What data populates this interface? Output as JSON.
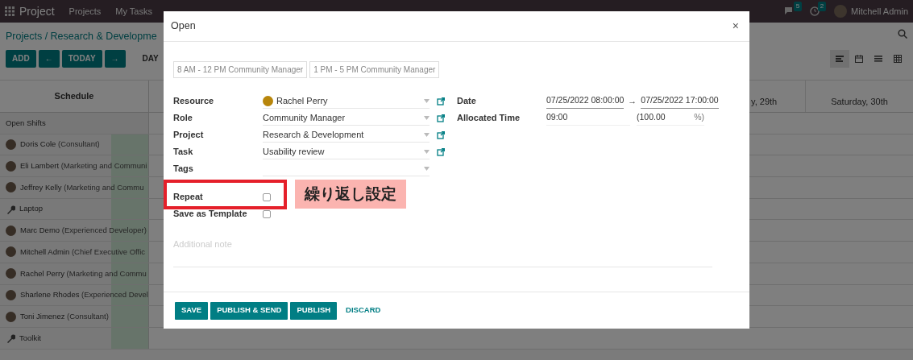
{
  "navbar": {
    "app": "Project",
    "menu": [
      "Projects",
      "My Tasks"
    ],
    "messages_badge": "5",
    "activities_badge": "2",
    "user": "Mitchell Admin"
  },
  "breadcrumb": "Projects / Research & Developme",
  "toolbar": [
    {
      "kind": "primary",
      "label": "ADD"
    },
    {
      "kind": "primary",
      "label": "←"
    },
    {
      "kind": "primary",
      "label": "TODAY"
    },
    {
      "kind": "primary",
      "label": "→"
    },
    {
      "kind": "scale",
      "label": "DAY"
    }
  ],
  "views": [
    {
      "kind": "gantt",
      "selected": true
    },
    {
      "kind": "calendar",
      "selected": false
    },
    {
      "kind": "list",
      "selected": false
    },
    {
      "kind": "pivot",
      "selected": false
    }
  ],
  "gantt": {
    "header": "Schedule",
    "columns": [
      "y, 29th",
      "Saturday, 30th"
    ],
    "rows": [
      {
        "kind": "group",
        "name": "Open Shifts"
      },
      {
        "kind": "person",
        "name": "Doris Cole",
        "role": "(Consultant)"
      },
      {
        "kind": "person",
        "name": "Eli Lambert",
        "role": "(Marketing and Communi"
      },
      {
        "kind": "person",
        "name": "Jeffrey Kelly",
        "role": "(Marketing and Commu"
      },
      {
        "kind": "equipment",
        "name": "Laptop"
      },
      {
        "kind": "person",
        "name": "Marc Demo",
        "role": "(Experienced Developer)"
      },
      {
        "kind": "person",
        "name": "Mitchell Admin",
        "role": "(Chief Executive Offic"
      },
      {
        "kind": "person",
        "name": "Rachel Perry",
        "role": "(Marketing and Commu"
      },
      {
        "kind": "person",
        "name": "Sharlene Rhodes",
        "role": "(Experienced Devel"
      },
      {
        "kind": "person",
        "name": "Toni Jimenez",
        "role": "(Consultant)"
      },
      {
        "kind": "equipment",
        "name": "Toolkit"
      }
    ]
  },
  "dialog": {
    "title": "Open",
    "close": "×",
    "templates": [
      "8 AM - 12 PM Community Manager",
      "1 PM - 5 PM Community Manager"
    ],
    "fields": [
      {
        "label": "Resource",
        "value": "Rachel Perry",
        "avatar": true,
        "link": true
      },
      {
        "label": "Role",
        "value": "Community Manager",
        "avatar": false,
        "link": true
      },
      {
        "label": "Project",
        "value": "Research & Development",
        "avatar": false,
        "link": true
      },
      {
        "label": "Task",
        "value": "Usability review",
        "avatar": false,
        "link": true
      },
      {
        "label": "Tags",
        "avatar": false,
        "link": false
      }
    ],
    "date": {
      "label": "Date",
      "start": "07/25/2022 08:00:00",
      "arrow": "→",
      "end": "07/25/2022 17:00:00"
    },
    "allocated": {
      "label": "Allocated Time",
      "hours": "09:00",
      "percent": "(100.00",
      "suffix": "%)"
    },
    "checks": [
      {
        "label": "Repeat",
        "checked": false
      },
      {
        "label": "Save as Template",
        "checked": false
      }
    ],
    "note_placeholder": "Additional note",
    "buttons": [
      {
        "kind": "primary",
        "label": "SAVE"
      },
      {
        "kind": "primary",
        "label": "PUBLISH & SEND"
      },
      {
        "kind": "primary",
        "label": "PUBLISH"
      },
      {
        "kind": "link",
        "label": "DISCARD"
      }
    ]
  },
  "annotation": {
    "label": "繰り返し設定"
  }
}
